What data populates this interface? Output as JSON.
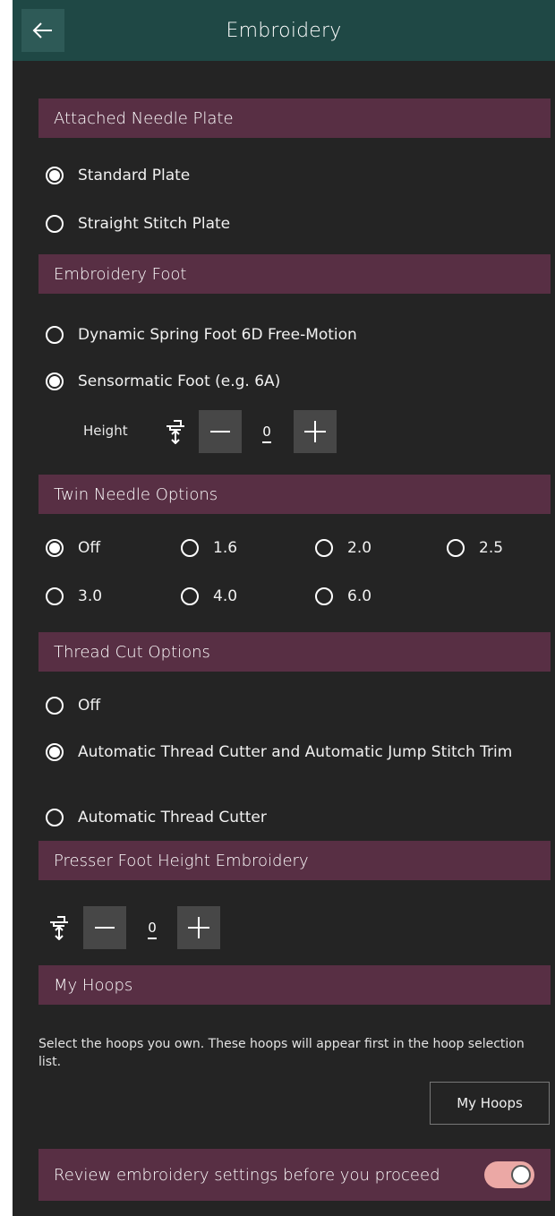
{
  "header": {
    "title": "Embroidery"
  },
  "needle_plate": {
    "heading": "Attached Needle Plate",
    "options": [
      {
        "label": "Standard Plate",
        "selected": true
      },
      {
        "label": "Straight Stitch Plate",
        "selected": false
      }
    ]
  },
  "foot": {
    "heading": "Embroidery Foot",
    "options": [
      {
        "label": "Dynamic Spring Foot 6D Free-Motion",
        "selected": false
      },
      {
        "label": "Sensormatic Foot (e.g. 6A)",
        "selected": true
      }
    ],
    "height_label": "Height",
    "height_value": "0"
  },
  "twin_needle": {
    "heading": "Twin Needle Options",
    "options": [
      {
        "label": "Off",
        "selected": true
      },
      {
        "label": "1.6",
        "selected": false
      },
      {
        "label": "2.0",
        "selected": false
      },
      {
        "label": "2.5",
        "selected": false
      },
      {
        "label": "3.0",
        "selected": false
      },
      {
        "label": "4.0",
        "selected": false
      },
      {
        "label": "6.0",
        "selected": false
      }
    ]
  },
  "thread_cut": {
    "heading": "Thread Cut Options",
    "options": [
      {
        "label": "Off",
        "selected": false
      },
      {
        "label": "Automatic Thread Cutter and Automatic Jump Stitch Trim",
        "selected": true
      },
      {
        "label": "Automatic Thread Cutter",
        "selected": false
      }
    ]
  },
  "presser_foot": {
    "heading": "Presser Foot Height Embroidery",
    "value": "0"
  },
  "hoops": {
    "heading": "My Hoops",
    "description": "Select the hoops you own. These hoops will appear first in the hoop selection list.",
    "button_label": "My Hoops"
  },
  "review": {
    "label": "Review embroidery settings before you proceed",
    "enabled": true,
    "toggle_color": "#eba8a5"
  },
  "colors": {
    "header_bg": "#1f4845",
    "section_bg": "#582f44",
    "page_bg": "#242424"
  }
}
